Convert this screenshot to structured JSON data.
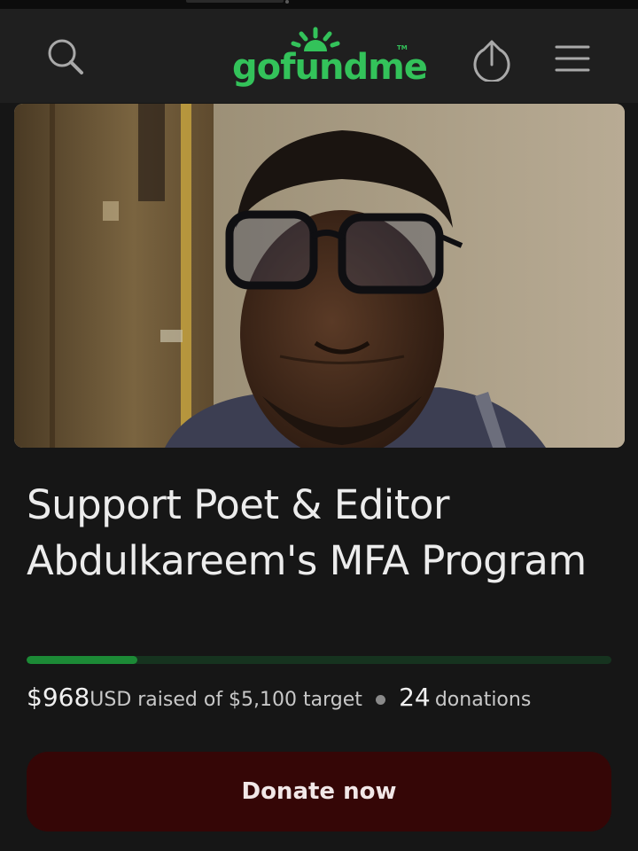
{
  "header": {
    "logo_text": "gofundme",
    "logo_tm": "TM",
    "search_icon": "search-icon",
    "share_icon": "share-upload-icon",
    "menu_icon": "hamburger-menu-icon"
  },
  "hero": {
    "image": "photo-of-man-with-glasses"
  },
  "campaign": {
    "title": "Support Poet & Editor Abdulkareem's MFA Program",
    "raised_amount": "$968",
    "raised_text": "USD raised of $5,100 target",
    "donations_count": "24",
    "donations_label": "donations",
    "progress_fraction": 0.19
  },
  "actions": {
    "donate_label": "Donate now"
  },
  "colors": {
    "brand_green": "#33c25a",
    "progress_fill": "#1c8a36",
    "progress_track": "#16331f",
    "donate_bg": "#350606",
    "background": "#161616",
    "header_bg": "#1f1f1f"
  }
}
